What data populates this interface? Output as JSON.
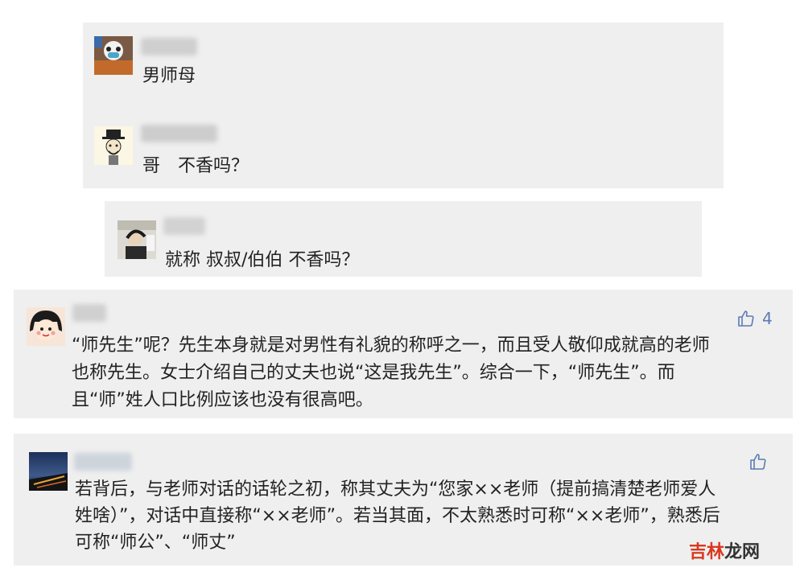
{
  "comments": [
    {
      "text": "男师母"
    },
    {
      "text": "哥　不香吗？"
    },
    {
      "text": "就称 叔叔/伯伯 不香吗？"
    },
    {
      "lines": [
        "“师先生”呢？先生本身就是对男性有礼貌的称呼之一，而且受人敬仰成就高的老师",
        "也称先生。女士介绍自己的丈夫也说“这是我先生”。综合一下，“师先生”。而",
        "且“师”姓人口比例应该也没有很高吧。"
      ],
      "likes": "4"
    },
    {
      "lines": [
        "若背后，与老师对话的话轮之初，称其丈夫为“您家××老师（提前搞清楚老师爱人",
        "姓啥）”，对话中直接称“××老师”。若当其面，不太熟悉时可称“××老师”，熟悉后",
        "可称“师公”、“师丈”"
      ]
    }
  ],
  "watermark": {
    "part1": "吉林",
    "part2": "龙网"
  },
  "colors": {
    "card": "#efefef",
    "like": "#5b7bb3",
    "wm_red": "#d9381e",
    "wm_dark": "#333333"
  }
}
